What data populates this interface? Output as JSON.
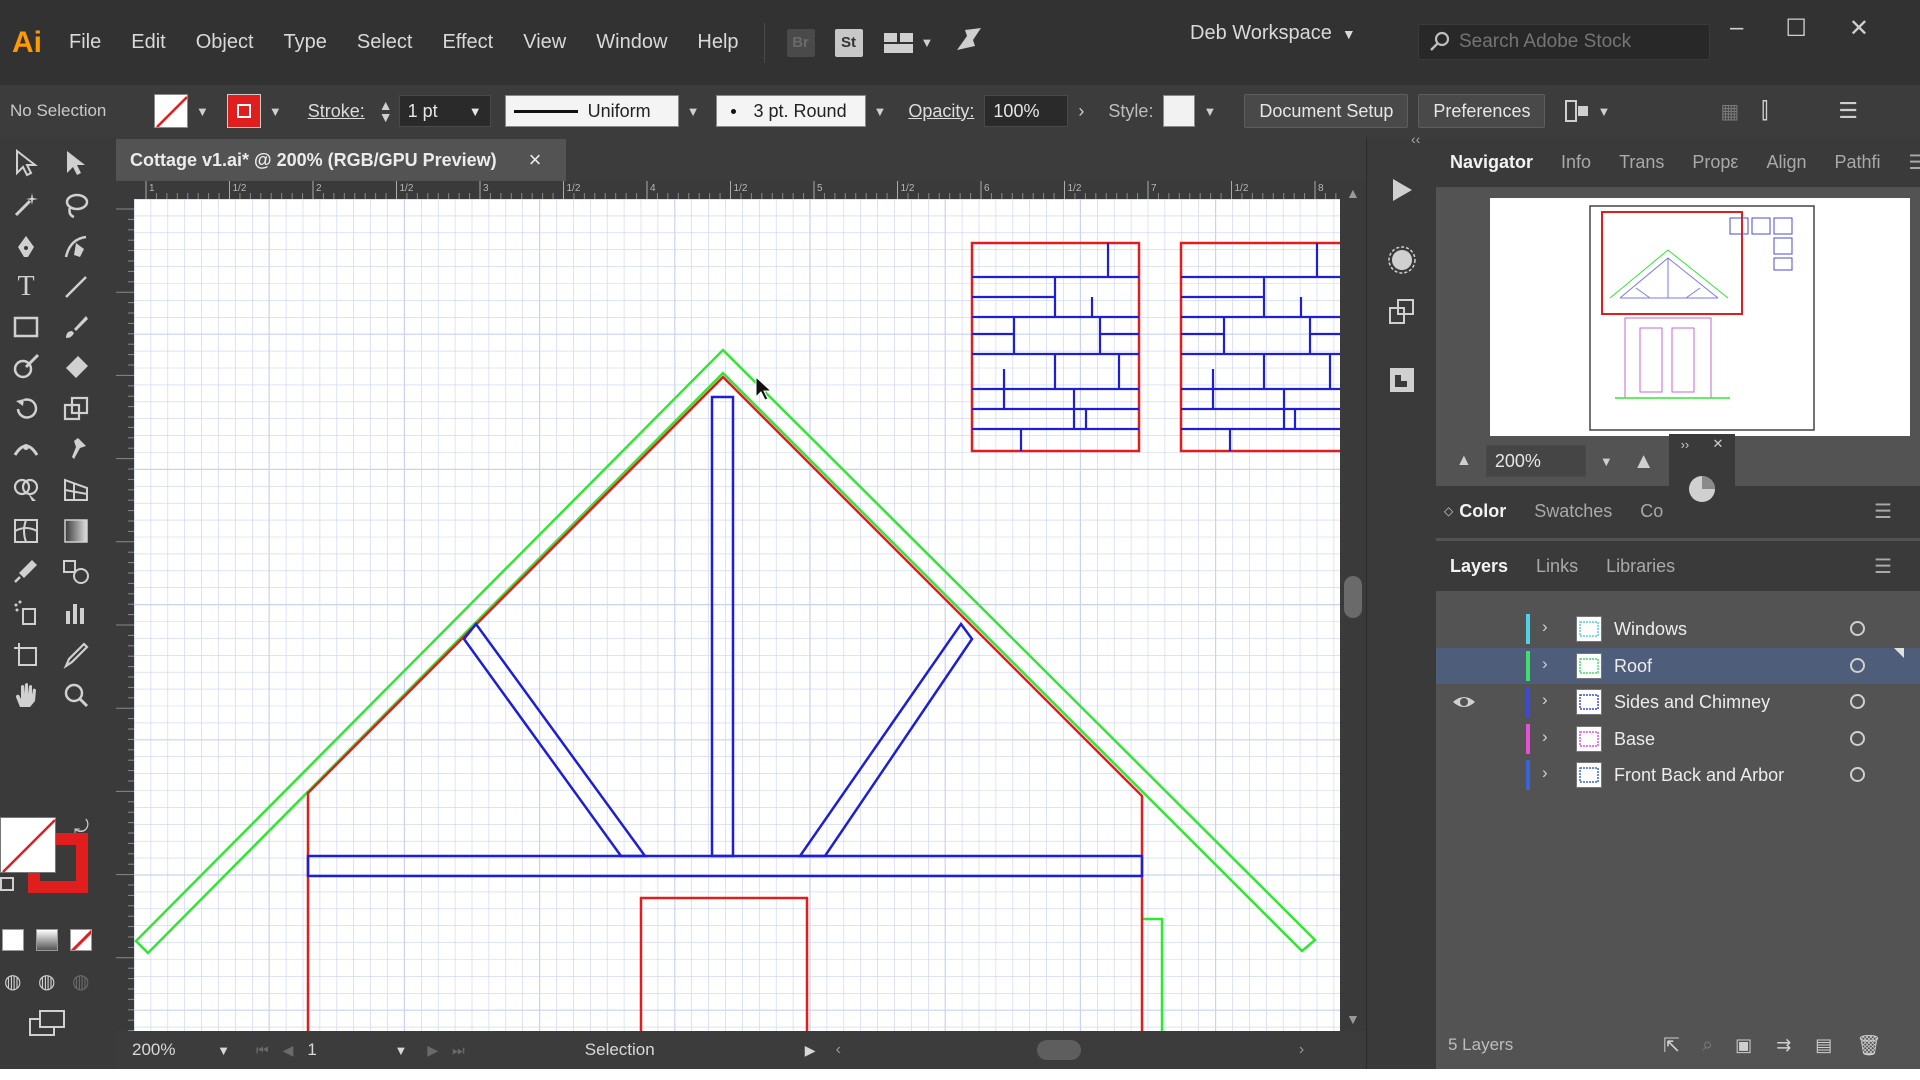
{
  "app": {
    "logo": "Ai",
    "menu": [
      "File",
      "Edit",
      "Object",
      "Type",
      "Select",
      "Effect",
      "View",
      "Window",
      "Help"
    ],
    "bridge_icon": "Br",
    "stock_icon": "St",
    "workspace": "Deb Workspace",
    "search_placeholder": "Search Adobe Stock"
  },
  "control_bar": {
    "selection": "No Selection",
    "stroke_label": "Stroke:",
    "stroke_weight": "1 pt",
    "stroke_profile": "Uniform",
    "brush": "3 pt. Round",
    "opacity_label": "Opacity:",
    "opacity": "100%",
    "style_label": "Style:",
    "doc_setup": "Document Setup",
    "preferences": "Preferences"
  },
  "document": {
    "tab_title": "Cottage v1.ai* @ 200% (RGB/GPU Preview)",
    "close": "×",
    "ruler_marks": [
      "1",
      "1/2",
      "2",
      "1/2",
      "3",
      "1/2",
      "4",
      "1/2",
      "5",
      "1/2",
      "6",
      "1/2",
      "7",
      "1/2",
      "8"
    ],
    "zoom": "200%",
    "artboard": "1",
    "status": "Selection"
  },
  "navigator": {
    "tabs": [
      "Navigator",
      "Info",
      "Trans",
      "Propε",
      "Align",
      "Pathfi"
    ],
    "zoom": "200%"
  },
  "color_panel": {
    "tabs": [
      "Color",
      "Swatches",
      "Co"
    ]
  },
  "layers_panel": {
    "tabs": [
      "Layers",
      "Links",
      "Libraries"
    ],
    "layers": [
      {
        "name": "Windows",
        "color": "#4fd1e8",
        "selected": false,
        "visible": false
      },
      {
        "name": "Roof",
        "color": "#3ee06b",
        "selected": true,
        "visible": false
      },
      {
        "name": "Sides and Chimney",
        "color": "#3a4bdc",
        "selected": false,
        "visible": true
      },
      {
        "name": "Base",
        "color": "#e84fd8",
        "selected": false,
        "visible": false
      },
      {
        "name": "Front Back and Arbor",
        "color": "#3a64dc",
        "selected": false,
        "visible": false
      }
    ],
    "count": "5 Layers"
  },
  "colors": {
    "roof_green": "#33e633",
    "frame_red": "#e01e1e",
    "truss_blue": "#1e1ed6",
    "grid": "#c9d3f0"
  }
}
